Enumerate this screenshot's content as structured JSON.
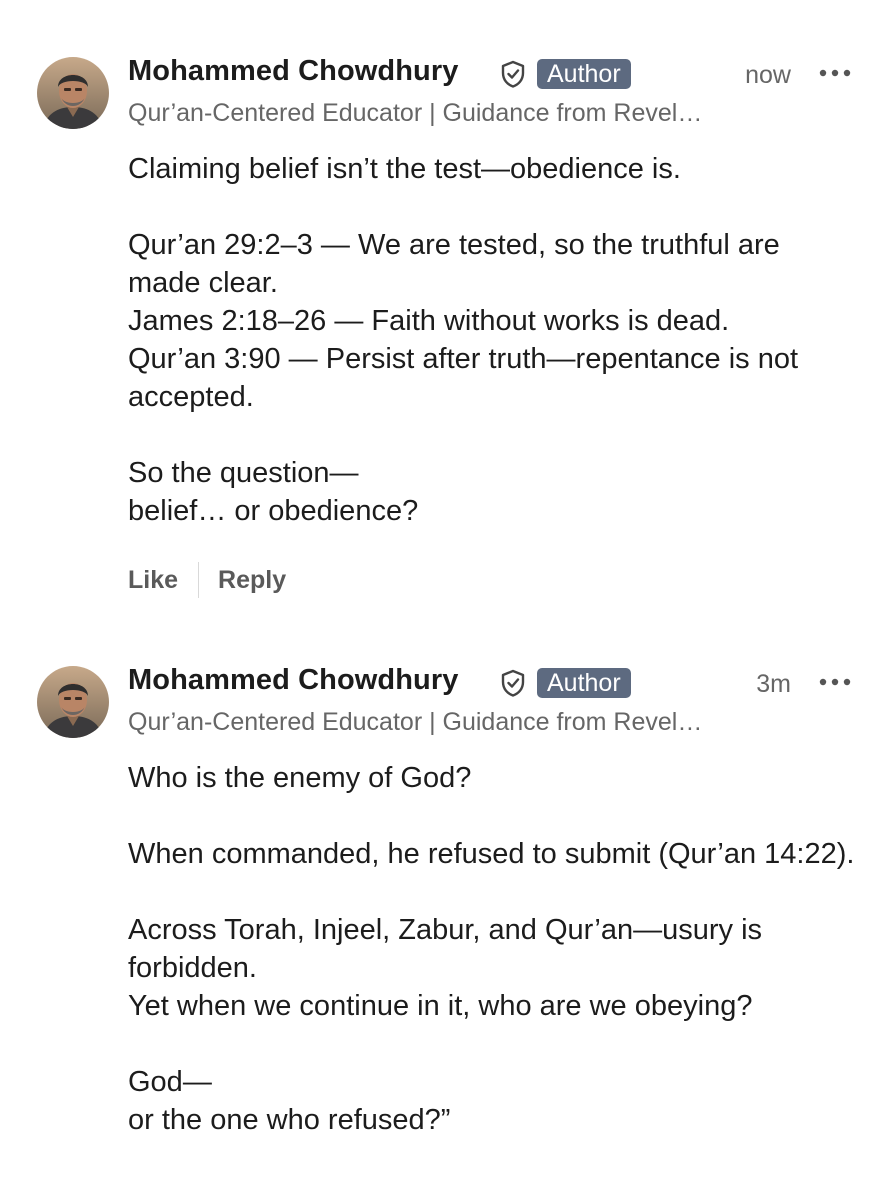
{
  "comments": [
    {
      "author": "Mohammed Chowdhury",
      "badge": "Author",
      "time": "now",
      "headline": "Qur’an-Centered Educator | Guidance from Revel…",
      "paragraphs": [
        [
          "Claiming belief isn’t the test—obedience is."
        ],
        [
          "Qur’an 29:2–3 — We are tested, so the truthful are made clear.",
          "James 2:18–26 — Faith without works is dead.",
          "Qur’an 3:90 — Persist after truth—repentance is not accepted."
        ],
        [
          "So the question—",
          "belief… or obedience?"
        ]
      ],
      "actions": {
        "like": "Like",
        "reply": "Reply"
      }
    },
    {
      "author": "Mohammed Chowdhury",
      "badge": "Author",
      "time": "3m",
      "headline": "Qur’an-Centered Educator | Guidance from Revel…",
      "paragraphs": [
        [
          "Who is the enemy of God?"
        ],
        [
          "When commanded, he refused to submit (Qur’an 14:22)."
        ],
        [
          "Across Torah, Injeel, Zabur, and Qur’an—usury is forbidden.",
          "Yet when we continue in it, who are we obeying?"
        ],
        [
          "God—",
          "or the one who refused?”"
        ]
      ]
    }
  ],
  "icons": {
    "verified": "shield-check-icon",
    "more": "more-horizontal-icon"
  },
  "colors": {
    "badge_bg": "#5d6a80",
    "secondary_text": "#666666",
    "primary_text": "#1c1c1c"
  }
}
